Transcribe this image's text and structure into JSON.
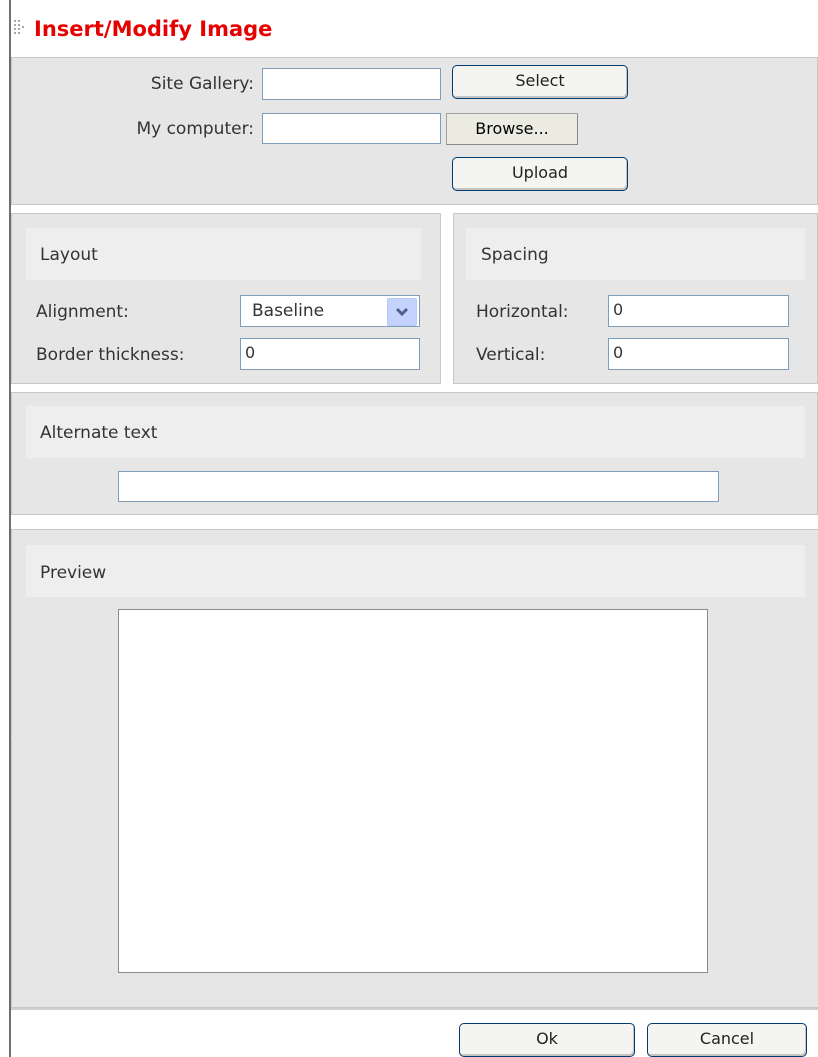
{
  "dialog": {
    "title": "Insert/Modify Image"
  },
  "source": {
    "site_gallery_label": "Site Gallery:",
    "site_gallery_value": "",
    "select_button": "Select",
    "my_computer_label": "My computer:",
    "my_computer_value": "",
    "browse_button": "Browse...",
    "upload_button": "Upload"
  },
  "layout": {
    "heading": "Layout",
    "alignment_label": "Alignment:",
    "alignment_value": "Baseline",
    "border_label": "Border thickness:",
    "border_value": "0"
  },
  "spacing": {
    "heading": "Spacing",
    "horizontal_label": "Horizontal:",
    "horizontal_value": "0",
    "vertical_label": "Vertical:",
    "vertical_value": "0"
  },
  "alternate": {
    "heading": "Alternate text",
    "value": ""
  },
  "preview": {
    "heading": "Preview"
  },
  "footer": {
    "ok_button": "Ok",
    "cancel_button": "Cancel"
  },
  "icons": {
    "grip": "drag-grip-icon",
    "dropdown": "chevron-down-icon"
  },
  "colors": {
    "title": "#e60000",
    "panel_bg": "#e6e6e6",
    "section_header_bg": "#eeeeee",
    "input_border": "#7f9db9",
    "button_border": "#003c74"
  }
}
